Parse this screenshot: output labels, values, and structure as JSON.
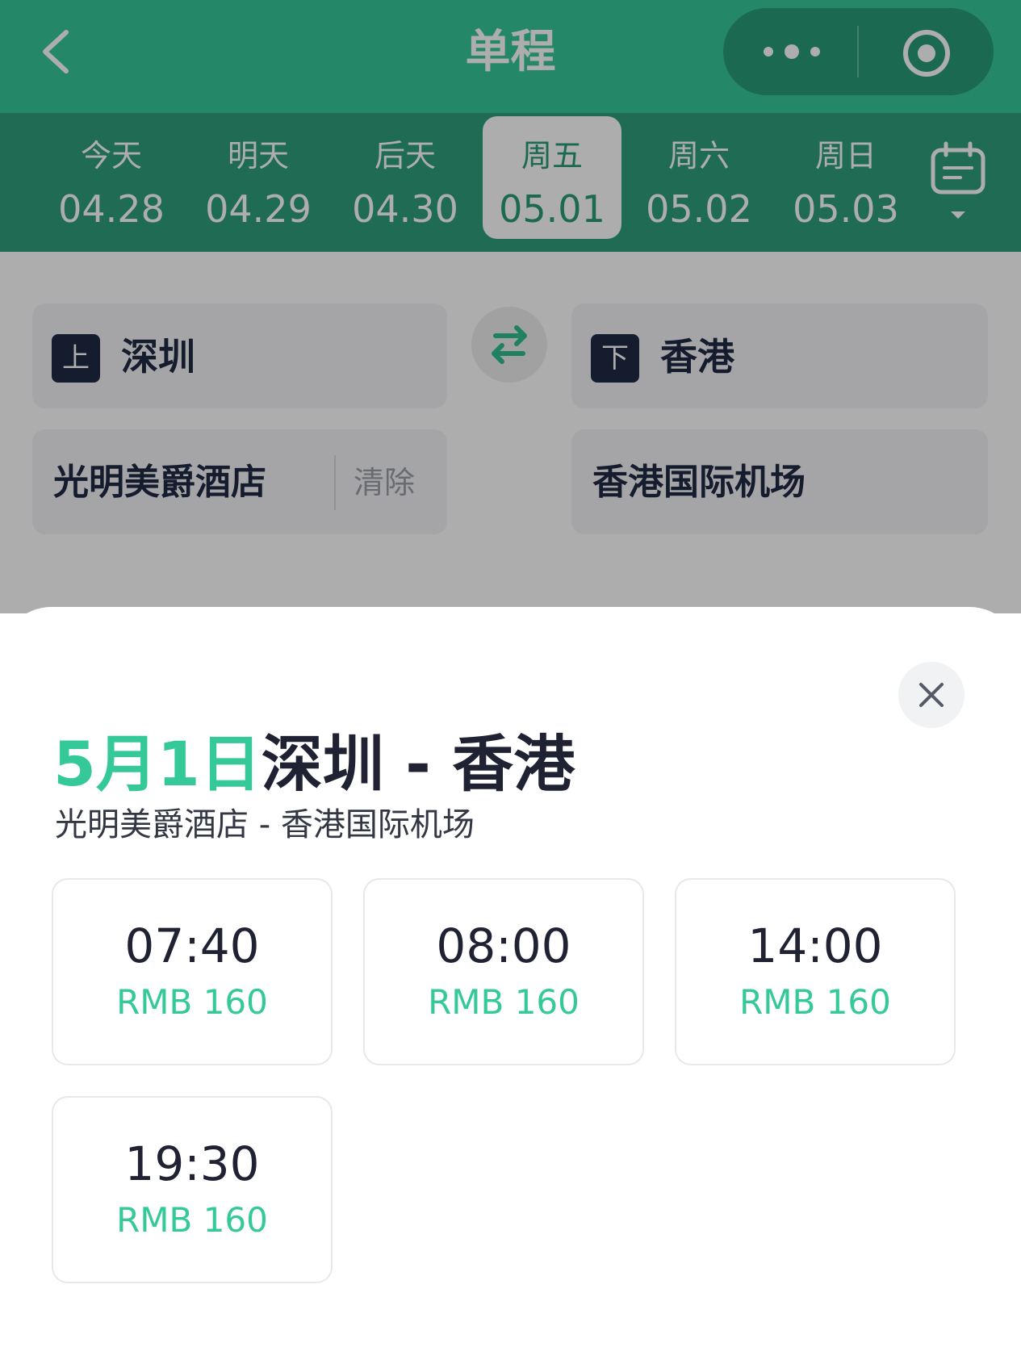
{
  "header": {
    "title": "单程",
    "icons": {
      "back": "chevron-left-icon",
      "more": "more-dots-icon",
      "target": "target-icon"
    }
  },
  "date_strip": {
    "items": [
      {
        "weekday": "今天",
        "date": "04.28",
        "selected": false
      },
      {
        "weekday": "明天",
        "date": "04.29",
        "selected": false
      },
      {
        "weekday": "后天",
        "date": "04.30",
        "selected": false
      },
      {
        "weekday": "周五",
        "date": "05.01",
        "selected": true
      },
      {
        "weekday": "周六",
        "date": "05.02",
        "selected": false
      },
      {
        "weekday": "周日",
        "date": "05.03",
        "selected": false
      }
    ],
    "calendar_icon": "calendar-icon"
  },
  "form": {
    "from": {
      "badge": "上",
      "city": "深圳",
      "place": "光明美爵酒店",
      "clear_label": "清除"
    },
    "to": {
      "badge": "下",
      "city": "香港",
      "place": "香港国际机场"
    },
    "swap_icon": "swap-arrows-icon"
  },
  "sheet": {
    "title_date": "5月1日",
    "title_route": "深圳 - 香港",
    "subtitle": "光明美爵酒店 - 香港国际机场",
    "close_icon": "close-icon",
    "slots": [
      {
        "time": "07:40",
        "price": "RMB 160"
      },
      {
        "time": "08:00",
        "price": "RMB 160"
      },
      {
        "time": "14:00",
        "price": "RMB 160"
      },
      {
        "time": "19:30",
        "price": "RMB 160"
      }
    ]
  },
  "colors": {
    "brand": "#35c99a",
    "brand_dark": "#2f9e7d",
    "text_dark": "#1e2233"
  }
}
